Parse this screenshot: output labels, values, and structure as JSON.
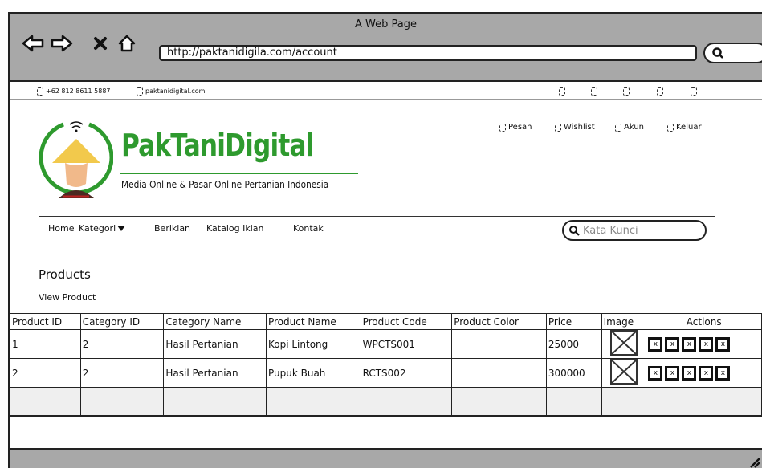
{
  "window": {
    "title": "A Web Page",
    "url": "http://paktanidigila.com/account"
  },
  "topbar": {
    "phone": "+62 812 8611 5887",
    "site": "paktanidigital.com"
  },
  "brand": {
    "name": "PakTaniDigital",
    "tagline": "Media Online & Pasar Online Pertanian Indonesia",
    "accent": "#2e9a2e"
  },
  "usermenu": [
    "Pesan",
    "Wishlist",
    "Akun",
    "Keluar"
  ],
  "nav": {
    "home": "Home",
    "kategori": "Kategori",
    "beriklan": "Beriklan",
    "katalog": "Katalog Iklan",
    "kontak": "Kontak",
    "search_placeholder": "Kata Kunci"
  },
  "page": {
    "title": "Products",
    "subtitle": "View Product"
  },
  "table": {
    "headers": [
      "Product ID",
      "Category ID",
      "Category Name",
      "Product Name",
      "Product Code",
      "Product Color",
      "Price",
      "Image",
      "Actions"
    ],
    "rows": [
      {
        "id": "1",
        "category_id": "2",
        "category_name": "Hasil Pertanian",
        "product_name": "Kopi Lintong",
        "code": "WPCTS001",
        "color": "",
        "price": "25000"
      },
      {
        "id": "2",
        "category_id": "2",
        "category_name": "Hasil Pertanian",
        "product_name": "Pupuk Buah",
        "code": "RCTS002",
        "color": "",
        "price": "300000"
      }
    ],
    "action_glyph": "x"
  }
}
